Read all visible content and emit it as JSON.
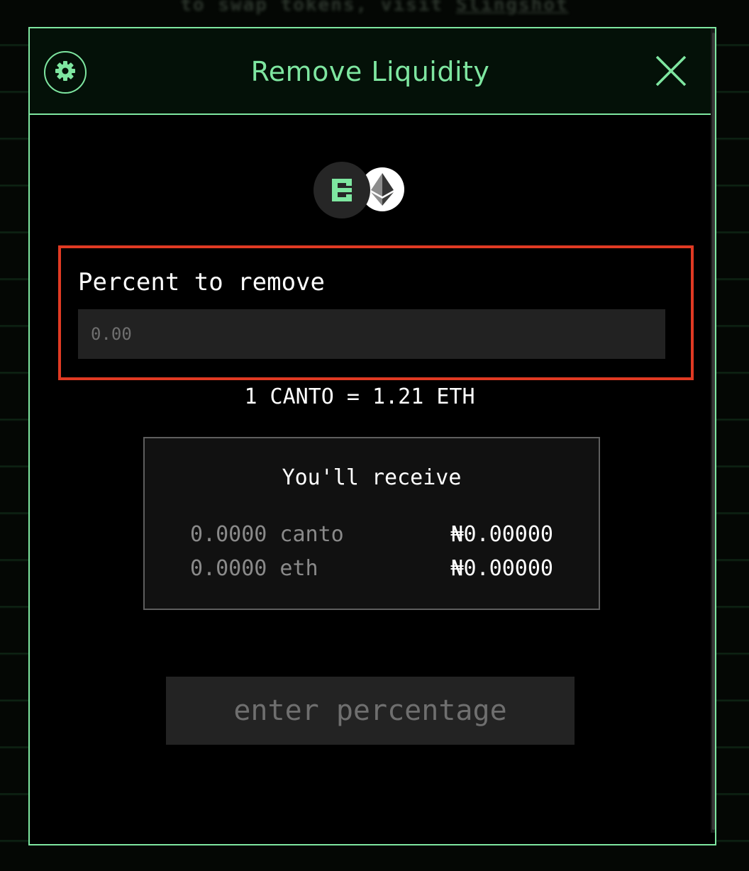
{
  "background": {
    "notice_text": "to swap tokens, visit",
    "notice_link": "Slingshot"
  },
  "modal": {
    "title": "Remove Liquidity",
    "settings_icon": "gear-icon",
    "close_icon": "close-icon"
  },
  "tokens": {
    "token_a": {
      "symbol": "CANTO",
      "icon": "canto-icon"
    },
    "token_b": {
      "symbol": "ETH",
      "icon": "eth-icon"
    }
  },
  "percent": {
    "label": "Percent to remove",
    "placeholder": "0.00",
    "value": ""
  },
  "rate": {
    "text": "1 CANTO = 1.21 ETH"
  },
  "receive": {
    "title": "You'll receive",
    "rows": [
      {
        "amount": "0.0000 canto",
        "value": "₦0.00000"
      },
      {
        "amount": "0.0000 eth",
        "value": "₦0.00000"
      }
    ]
  },
  "action": {
    "label": "enter percentage"
  },
  "colors": {
    "accent": "#7ee6a0",
    "highlight_border": "#e03a23",
    "modal_bg": "#000000",
    "input_bg": "#222222"
  }
}
